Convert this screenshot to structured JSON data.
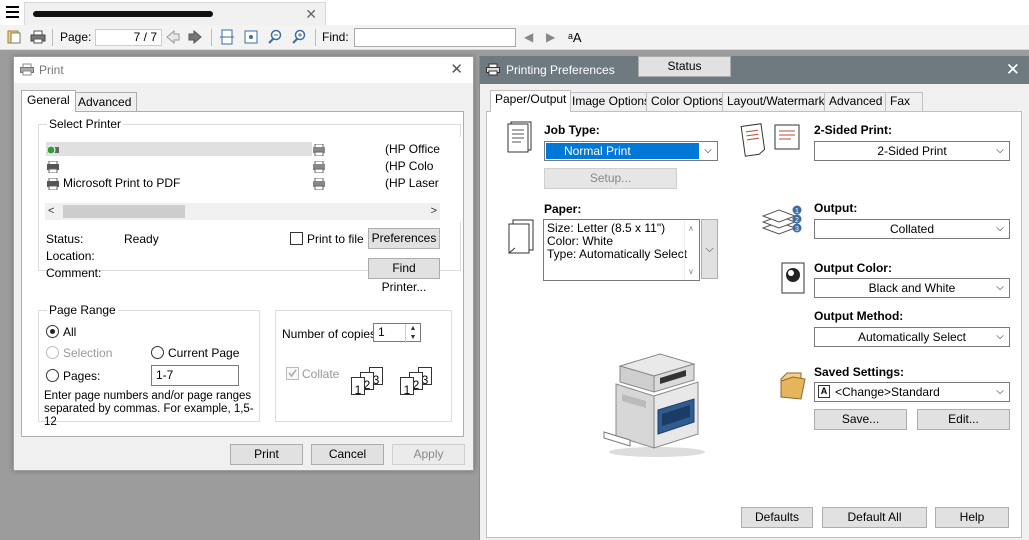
{
  "viewer": {
    "page_label": "Page:",
    "page_value": "7 / 7",
    "find_label": "Find:",
    "find_value": ""
  },
  "print_dialog": {
    "title": "Print",
    "tabs": [
      "General",
      "Advanced"
    ],
    "select_printer_label": "Select Printer",
    "printers": {
      "p1": "",
      "p2": "",
      "p3": "Microsoft Print to PDF",
      "p4": "(HP Office",
      "p5": "(HP Colo",
      "p6": "(HP Laser"
    },
    "status_label": "Status:",
    "status_value": "Ready",
    "location_label": "Location:",
    "comment_label": "Comment:",
    "print_to_file_label": "Print to file",
    "preferences_label": "Preferences",
    "find_printer_label": "Find Printer...",
    "page_range_label": "Page Range",
    "range_all": "All",
    "range_selection": "Selection",
    "range_current": "Current Page",
    "range_pages": "Pages:",
    "pages_value": "1-7",
    "pages_hint": "Enter page numbers and/or page ranges separated by commas.  For example, 1,5-12",
    "copies_label": "Number of copies:",
    "copies_value": "1",
    "collate_label": "Collate",
    "print_btn": "Print",
    "cancel_btn": "Cancel",
    "apply_btn": "Apply"
  },
  "pref_dialog": {
    "title": "Printing Preferences",
    "tabs": [
      "Paper/Output",
      "Image Options",
      "Color Options",
      "Layout/Watermark",
      "Advanced",
      "Fax"
    ],
    "job_type_label": "Job Type:",
    "job_type_value": "Normal Print",
    "setup_btn": "Setup...",
    "paper_label": "Paper:",
    "paper_lines": [
      "Size: Letter (8.5 x 11\")",
      "Color: White",
      "Type: Automatically Select"
    ],
    "two_sided_label": "2-Sided Print:",
    "two_sided_value": "2-Sided Print",
    "output_label": "Output:",
    "output_value": "Collated",
    "output_color_label": "Output Color:",
    "output_color_value": "Black and White",
    "output_method_label": "Output Method:",
    "output_method_value": "Automatically Select",
    "saved_settings_label": "Saved Settings:",
    "saved_settings_value": "<Change>Standard",
    "save_btn": "Save...",
    "edit_btn": "Edit...",
    "status_btn": "Status",
    "defaults_btn": "Defaults",
    "default_all_btn": "Default All",
    "help_btn": "Help"
  }
}
